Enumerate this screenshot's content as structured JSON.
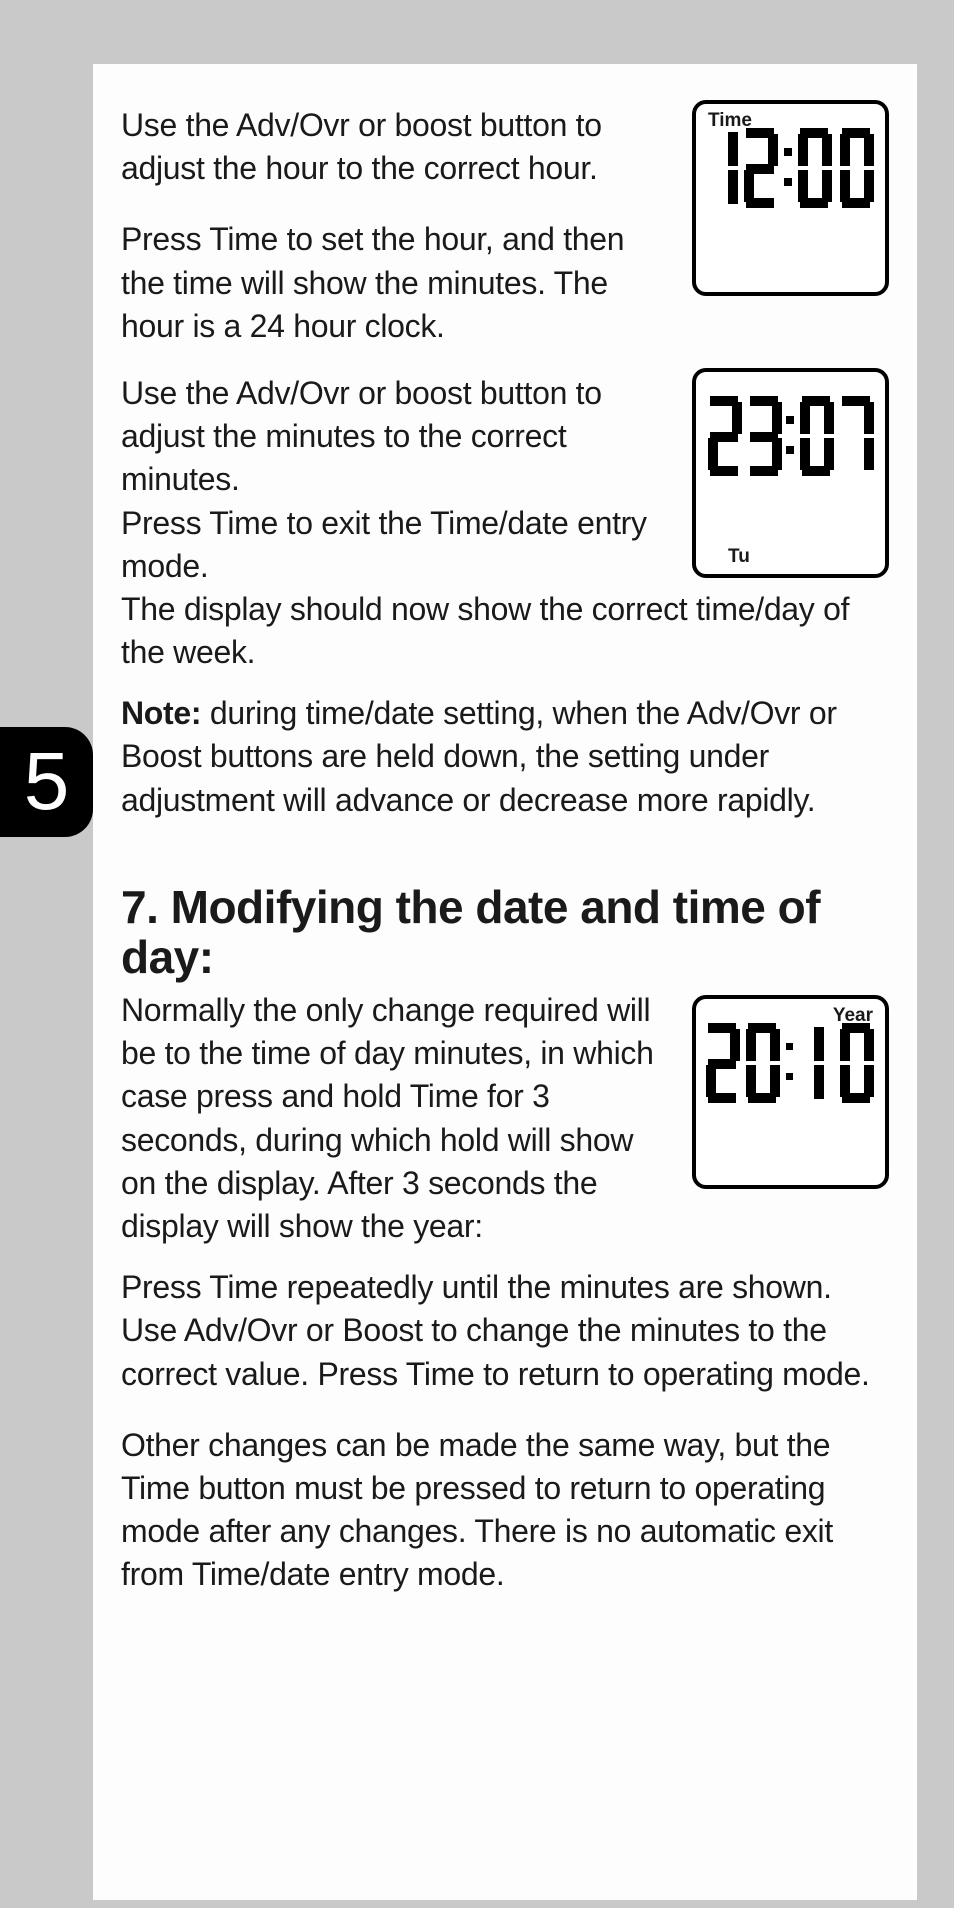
{
  "page_tab": "5",
  "lcd1": {
    "label_tl": "Time",
    "digits": "12:00"
  },
  "lcd2": {
    "digits": "23:07",
    "label_bot": "Tu"
  },
  "lcd3": {
    "label_tr": "Year",
    "digits": "2010"
  },
  "section_a": {
    "p1": "Use the Adv/Ovr or boost button to adjust the hour to the correct hour.",
    "p2": "Press Time to set the hour, and then the time will show the minutes. The hour is a 24 hour clock.",
    "p3": "Use the Adv/Ovr or boost button to adjust the minutes to the correct minutes.",
    "p4": "Press Time to exit the Time/date entry mode.",
    "p5": "The display should now show the correct time/day of the week.",
    "note_label": "Note:",
    "note_body": " during time/date setting, when the Adv/Ovr or Boost buttons are held down, the setting under adjustment will advance or decrease more rapidly."
  },
  "section_b": {
    "heading": "7. Modifying the date and time of day:",
    "p1": "Normally the only change required will be to the time of day minutes, in which case press and hold Time for 3 seconds, during which hold will show on the display. After 3 seconds the display will show the year:",
    "p2": "Press Time repeatedly until the minutes are shown. Use Adv/Ovr or Boost to change the minutes to the correct value. Press Time to return to operating mode.",
    "p3": "Other changes can be made the same way, but the Time button must be pressed to return to operating mode after any changes. There is no automatic exit from Time/date entry mode."
  }
}
